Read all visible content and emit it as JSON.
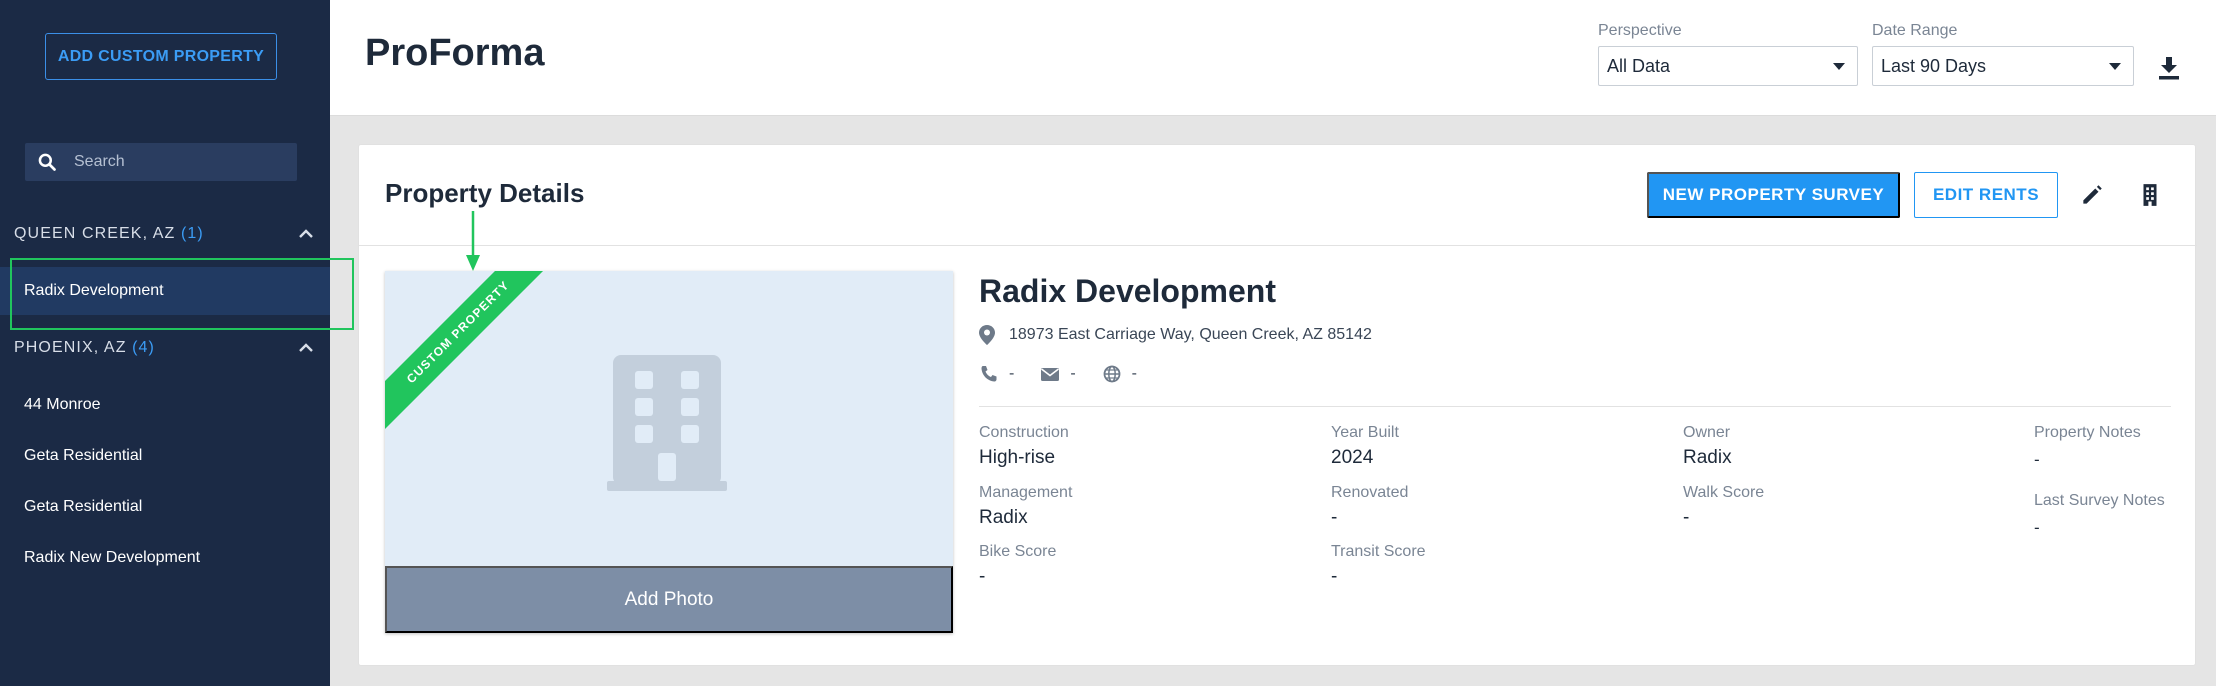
{
  "sidebar": {
    "add_button": "ADD CUSTOM PROPERTY",
    "search_placeholder": "Search",
    "groups": [
      {
        "name": "QUEEN CREEK, AZ",
        "count": "(1)",
        "items": [
          "Radix Development"
        ]
      },
      {
        "name": "PHOENIX, AZ",
        "count": "(4)",
        "items": [
          "44 Monroe",
          "Geta Residential",
          "Geta Residential",
          "Radix New Development"
        ]
      }
    ]
  },
  "header": {
    "title": "ProForma",
    "perspective_label": "Perspective",
    "perspective_value": "All Data",
    "date_range_label": "Date Range",
    "date_range_value": "Last 90 Days"
  },
  "card": {
    "title": "Property Details",
    "new_survey_label": "NEW PROPERTY SURVEY",
    "edit_rents_label": "EDIT RENTS",
    "ribbon": "CUSTOM PROPERTY",
    "add_photo": "Add Photo"
  },
  "property": {
    "name": "Radix Development",
    "address": "18973 East Carriage Way, Queen Creek, AZ 85142",
    "phone": "-",
    "email": "-",
    "website": "-",
    "details": {
      "construction_label": "Construction",
      "construction": "High-rise",
      "year_built_label": "Year Built",
      "year_built": "2024",
      "owner_label": "Owner",
      "owner": "Radix",
      "property_notes_label": "Property Notes",
      "property_notes": "-",
      "management_label": "Management",
      "management": "Radix",
      "renovated_label": "Renovated",
      "renovated": "-",
      "walk_score_label": "Walk Score",
      "walk_score": "-",
      "last_survey_notes_label": "Last Survey Notes",
      "last_survey_notes": "-",
      "bike_score_label": "Bike Score",
      "bike_score": "-",
      "transit_score_label": "Transit Score",
      "transit_score": "-"
    }
  },
  "colors": {
    "sidebar_bg": "#1b2a45",
    "accent": "#2196f3",
    "ribbon": "#21c55d"
  },
  "icons": [
    "search-icon",
    "chevron-up-icon",
    "download-icon",
    "pencil-icon",
    "building-icon",
    "map-pin-icon",
    "phone-icon",
    "envelope-icon",
    "globe-icon"
  ]
}
